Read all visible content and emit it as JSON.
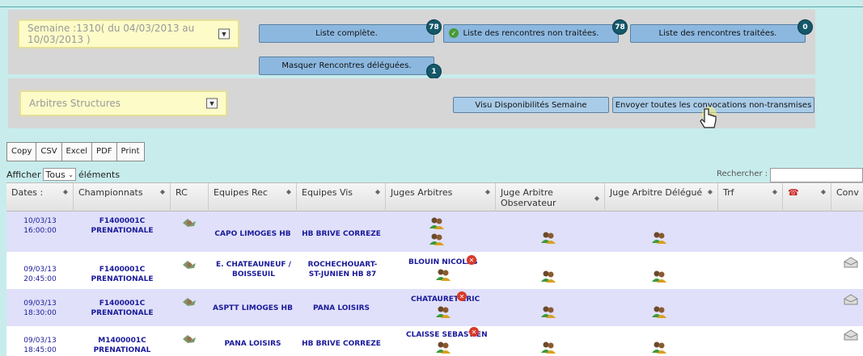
{
  "filters": {
    "week_select": "Semaine :1310( du 04/03/2013 au 10/03/2013 )",
    "arbitres_select": "Arbitres Structures"
  },
  "buttons": {
    "liste_complete": "Liste complète.",
    "liste_complete_count": "78",
    "non_traitees": "Liste des rencontres non traitées.",
    "non_traitees_count": "78",
    "traitees": "Liste des rencontres traitées.",
    "traitees_count": "0",
    "masquer": "Masquer Rencontres déléguées.",
    "masquer_count": "1",
    "visu": "Visu Disponibilités Semaine",
    "envoyer": "Envoyer toutes les convocations non-transmises"
  },
  "export": [
    "Copy",
    "CSV",
    "Excel",
    "PDF",
    "Print"
  ],
  "length": {
    "prefix": "Afficher",
    "value": "Tous",
    "suffix": "éléments"
  },
  "search": {
    "label": "Rechercher :"
  },
  "columns": {
    "dates": "Dates :",
    "championnats": "Championnats",
    "rc": "RC",
    "equipes_rec": "Equipes Rec",
    "equipes_vis": "Equipes Vis",
    "juges": "Juges Arbitres",
    "observateur": "Juge Arbitre Observateur",
    "delegue": "Juge Arbitre Délégué",
    "trf": "Trf",
    "conv": "Conv"
  },
  "rows": [
    {
      "date": "10/03/13",
      "time": "16:00:00",
      "champ_code": "F1400001C",
      "champ_name": "PRENATIONALE",
      "rec": "CAPO LIMOGES HB",
      "vis": "HB BRIVE CORREZE",
      "juge": ""
    },
    {
      "date": "09/03/13",
      "time": "20:45:00",
      "champ_code": "F1400001C",
      "champ_name": "PRENATIONALE",
      "rec": "E. CHATEAUNEUF / BOISSEUIL",
      "vis": "ROCHECHOUART-ST-JUNIEN HB 87",
      "juge": "BLOUIN NICOLAS"
    },
    {
      "date": "09/03/13",
      "time": "18:30:00",
      "champ_code": "F1400001C",
      "champ_name": "PRENATIONALE",
      "rec": "ASPTT LIMOGES HB",
      "vis": "PANA LOISIRS",
      "juge": "CHATAURET ERIC"
    },
    {
      "date": "09/03/13",
      "time": "18:45:00",
      "champ_code": "M1400001C",
      "champ_name": "PRENATIONAL",
      "rec": "PANA LOISIRS",
      "vis": "HB BRIVE CORREZE",
      "juge": "CLAISSE SEBASTIEN"
    }
  ]
}
